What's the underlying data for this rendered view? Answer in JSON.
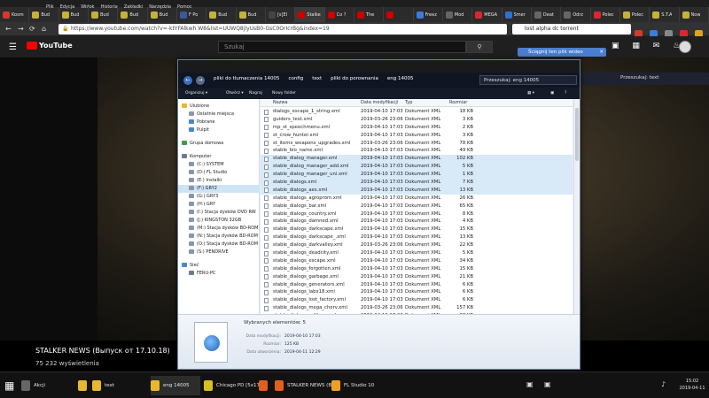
{
  "browser": {
    "menu": [
      "Plik",
      "Edycja",
      "Widok",
      "Historia",
      "Zakładki",
      "Narzędzia",
      "Pomoc"
    ],
    "tabs": [
      {
        "label": "Kosm",
        "color": "#d33a2c"
      },
      {
        "label": "Bud",
        "color": "#c5b23a"
      },
      {
        "label": "Bud",
        "color": "#c5b23a"
      },
      {
        "label": "Bud",
        "color": "#c5b23a"
      },
      {
        "label": "Bud",
        "color": "#c5b23a"
      },
      {
        "label": "Bud",
        "color": "#c5b23a"
      },
      {
        "label": "F Po",
        "color": "#3b5998"
      },
      {
        "label": "Bud",
        "color": "#c5b23a"
      },
      {
        "label": "Bud",
        "color": "#c5b23a"
      },
      {
        "label": "[s]El",
        "color": "#444"
      },
      {
        "label": "Stalke",
        "color": "#cc0000"
      },
      {
        "label": "Co ?",
        "color": "#cc0000"
      },
      {
        "label": "The",
        "color": "#cc0000"
      },
      {
        "label": "",
        "color": "#cc0000"
      },
      {
        "label": "Freez",
        "color": "#3d7bd9"
      },
      {
        "label": "Mod",
        "color": "#666"
      },
      {
        "label": "MEGA",
        "color": "#d9272e"
      },
      {
        "label": "Smer",
        "color": "#2e6fd0"
      },
      {
        "label": "Deat",
        "color": "#666"
      },
      {
        "label": "Odrz",
        "color": "#666"
      },
      {
        "label": "Polec",
        "color": "#d9272e"
      },
      {
        "label": "Polec",
        "color": "#c5b23a"
      },
      {
        "label": "S.T.A",
        "color": "#c5b23a"
      },
      {
        "label": "Now",
        "color": "#c5b23a"
      }
    ],
    "url": "https://www.youtube.com/watch?v=-ktYFAlkwh W8&list=UUWQ8jlyUsB0-GsC0OrIcrBg&index=19",
    "search_value": "lost alpha dc torrent",
    "download_banner": "Ściągnij ten plik wideo"
  },
  "youtube": {
    "logo_text": "YouTube",
    "search_placeholder": "Szukaj",
    "video_title": "STALKER NEWS (Выпуск от 17.10.18)",
    "views": "75 232 wyświetlenia"
  },
  "explorer": {
    "breadcrumbs": [
      "pliki do tlumaczenia 14005",
      "config",
      "text",
      "pliki do porownania",
      "eng 14005"
    ],
    "search_placeholder": "Przeszukaj: eng 14005",
    "toolbar": {
      "organize": "Organizuj ▾",
      "open": "Otwórz ▾",
      "burn": "Nagraj",
      "new_folder": "Nowy folder"
    },
    "nav": [
      {
        "label": "Ulubione",
        "color": "#e8b730",
        "indent": 0,
        "gap": 0
      },
      {
        "label": "Ostatnie miejsca",
        "color": "#8899aa",
        "indent": 1,
        "gap": 0
      },
      {
        "label": "Pobrane",
        "color": "#4a86c8",
        "indent": 1,
        "gap": 0
      },
      {
        "label": "Pulpit",
        "color": "#4a86c8",
        "indent": 1,
        "gap": 0
      },
      {
        "label": "Grupa domowa",
        "color": "#3a9c4a",
        "indent": 0,
        "gap": 1
      },
      {
        "label": "Komputer",
        "color": "#6d7b8f",
        "indent": 0,
        "gap": 1
      },
      {
        "label": "(C:) SYSTEM",
        "color": "#8a96a8",
        "indent": 1,
        "gap": 0
      },
      {
        "label": "(D:) FL Studio",
        "color": "#8a96a8",
        "indent": 1,
        "gap": 0
      },
      {
        "label": "(E:) Instalki",
        "color": "#8a96a8",
        "indent": 1,
        "gap": 0
      },
      {
        "label": "(F:) GRY2",
        "color": "#8a96a8",
        "indent": 1,
        "gap": 0,
        "selected": true
      },
      {
        "label": "(G:) GRY3",
        "color": "#8a96a8",
        "indent": 1,
        "gap": 0
      },
      {
        "label": "(H:) GRY",
        "color": "#8a96a8",
        "indent": 1,
        "gap": 0
      },
      {
        "label": "(I:) Stacja dysków DVD RW",
        "color": "#8a96a8",
        "indent": 1,
        "gap": 0
      },
      {
        "label": "(J:) KINGSTON 32GB",
        "color": "#8a96a8",
        "indent": 1,
        "gap": 0
      },
      {
        "label": "(M:) Stacja dysków BD-ROM",
        "color": "#8a96a8",
        "indent": 1,
        "gap": 0
      },
      {
        "label": "(N:) Stacja dysków BD-ROM",
        "color": "#8a96a8",
        "indent": 1,
        "gap": 0
      },
      {
        "label": "(O:) Stacja dysków BD-ROM",
        "color": "#8a96a8",
        "indent": 1,
        "gap": 0
      },
      {
        "label": "(S:) PENDRIVE",
        "color": "#8a96a8",
        "indent": 1,
        "gap": 0
      },
      {
        "label": "Sieć",
        "color": "#4a86c8",
        "indent": 0,
        "gap": 1
      },
      {
        "label": "FERU-PC",
        "color": "#6d7b8f",
        "indent": 1,
        "gap": 0
      }
    ],
    "columns": [
      "Nazwa",
      "Data modyfikacji",
      "Typ",
      "Rozmiar"
    ],
    "files": [
      {
        "name": "dialogs_escape_1_string.xml",
        "date": "2019-04-10 17:03",
        "type": "Dokument XML",
        "size": "18 KB",
        "sel": false
      },
      {
        "name": "guiders_text.xml",
        "date": "2019-03-26 23:06",
        "type": "Dokument XML",
        "size": "3 KB",
        "sel": false
      },
      {
        "name": "mp_st_speechmenu.xml",
        "date": "2019-04-10 17:03",
        "type": "Dokument XML",
        "size": "2 KB",
        "sel": false
      },
      {
        "name": "st_crow_hunter.xml",
        "date": "2019-04-10 17:03",
        "type": "Dokument XML",
        "size": "3 KB",
        "sel": false
      },
      {
        "name": "st_items_weapons_upgrades.xml",
        "date": "2019-03-26 23:06",
        "type": "Dokument XML",
        "size": "78 KB",
        "sel": false
      },
      {
        "name": "stable_bio_name.xml",
        "date": "2019-04-10 17:03",
        "type": "Dokument XML",
        "size": "49 KB",
        "sel": false
      },
      {
        "name": "stable_dialog_manager.xml",
        "date": "2019-04-10 17:03",
        "type": "Dokument XML",
        "size": "102 KB",
        "sel": true
      },
      {
        "name": "stable_dialog_manager_add.xml",
        "date": "2019-04-10 17:03",
        "type": "Dokument XML",
        "size": "5 KB",
        "sel": true
      },
      {
        "name": "stable_dialog_manager_uni.xml",
        "date": "2019-04-10 17:03",
        "type": "Dokument XML",
        "size": "1 KB",
        "sel": true
      },
      {
        "name": "stable_dialogs.xml",
        "date": "2019-04-10 17:03",
        "type": "Dokument XML",
        "size": "7 KB",
        "sel": true
      },
      {
        "name": "stable_dialogs_aes.xml",
        "date": "2019-04-10 17:03",
        "type": "Dokument XML",
        "size": "13 KB",
        "sel": true
      },
      {
        "name": "stable_dialogs_agroprom.xml",
        "date": "2019-04-10 17:03",
        "type": "Dokument XML",
        "size": "26 KB",
        "sel": false
      },
      {
        "name": "stable_dialogs_bar.xml",
        "date": "2019-04-10 17:03",
        "type": "Dokument XML",
        "size": "65 KB",
        "sel": false
      },
      {
        "name": "stable_dialogs_country.xml",
        "date": "2019-04-10 17:03",
        "type": "Dokument XML",
        "size": "8 KB",
        "sel": false
      },
      {
        "name": "stable_dialogs_damned.xml",
        "date": "2019-04-10 17:03",
        "type": "Dokument XML",
        "size": "4 KB",
        "sel": false
      },
      {
        "name": "stable_dialogs_darkscape.xml",
        "date": "2019-04-10 17:03",
        "type": "Dokument XML",
        "size": "15 KB",
        "sel": false
      },
      {
        "name": "stable_dialogs_darkscape_.xml",
        "date": "2019-04-10 17:03",
        "type": "Dokument XML",
        "size": "13 KB",
        "sel": false
      },
      {
        "name": "stable_dialogs_darkvalley.xml",
        "date": "2019-03-26 23:06",
        "type": "Dokument XML",
        "size": "22 KB",
        "sel": false
      },
      {
        "name": "stable_dialogs_deadcity.xml",
        "date": "2019-04-10 17:03",
        "type": "Dokument XML",
        "size": "5 KB",
        "sel": false
      },
      {
        "name": "stable_dialogs_escape.xml",
        "date": "2019-04-10 17:03",
        "type": "Dokument XML",
        "size": "34 KB",
        "sel": false
      },
      {
        "name": "stable_dialogs_forgotten.xml",
        "date": "2019-04-10 17:03",
        "type": "Dokument XML",
        "size": "15 KB",
        "sel": false
      },
      {
        "name": "stable_dialogs_garbage.xml",
        "date": "2019-04-10 17:03",
        "type": "Dokument XML",
        "size": "21 KB",
        "sel": false
      },
      {
        "name": "stable_dialogs_generators.xml",
        "date": "2019-04-10 17:03",
        "type": "Dokument XML",
        "size": "6 KB",
        "sel": false
      },
      {
        "name": "stable_dialogs_labx18.xml",
        "date": "2019-04-10 17:03",
        "type": "Dokument XML",
        "size": "6 KB",
        "sel": false
      },
      {
        "name": "stable_dialogs_lost_factory.xml",
        "date": "2019-04-10 17:03",
        "type": "Dokument XML",
        "size": "6 KB",
        "sel": false
      },
      {
        "name": "stable_dialogs_mega_cherv.xml",
        "date": "2019-03-26 23:06",
        "type": "Dokument XML",
        "size": "157 KB",
        "sel": false
      },
      {
        "name": "stable_dialogs_military.xml",
        "date": "2019-04-10 17:03",
        "type": "Dokument XML",
        "size": "38 KB",
        "sel": false
      }
    ],
    "details": {
      "selected": "Wybranych elementów: 5",
      "modified_label": "Data modyfikacji:",
      "modified_value": "2019-04-10 17:03",
      "size_label": "Rozmiar:",
      "size_value": "125 KB",
      "created_label": "Data utworzenia:",
      "created_value": "2019-04-11 12:29"
    }
  },
  "right_panel": {
    "search": "Przeszukaj: text"
  },
  "taskbar": {
    "items": [
      {
        "label": "Akcji",
        "color": "#666"
      },
      {
        "label": "",
        "color": "#e8b730"
      },
      {
        "label": "text",
        "color": "#e8b730"
      },
      {
        "label": "eng 14005",
        "color": "#e8b730"
      },
      {
        "label": "Chicago PD [5x17]...",
        "color": "#d9c020"
      },
      {
        "label": "",
        "color": "#e06020"
      },
      {
        "label": "STALKER NEWS (B...",
        "color": "#e06020"
      },
      {
        "label": "FL Studio 10",
        "color": "#f0a020"
      }
    ],
    "clock_time": "15:02",
    "clock_date": "2019-04-11"
  }
}
